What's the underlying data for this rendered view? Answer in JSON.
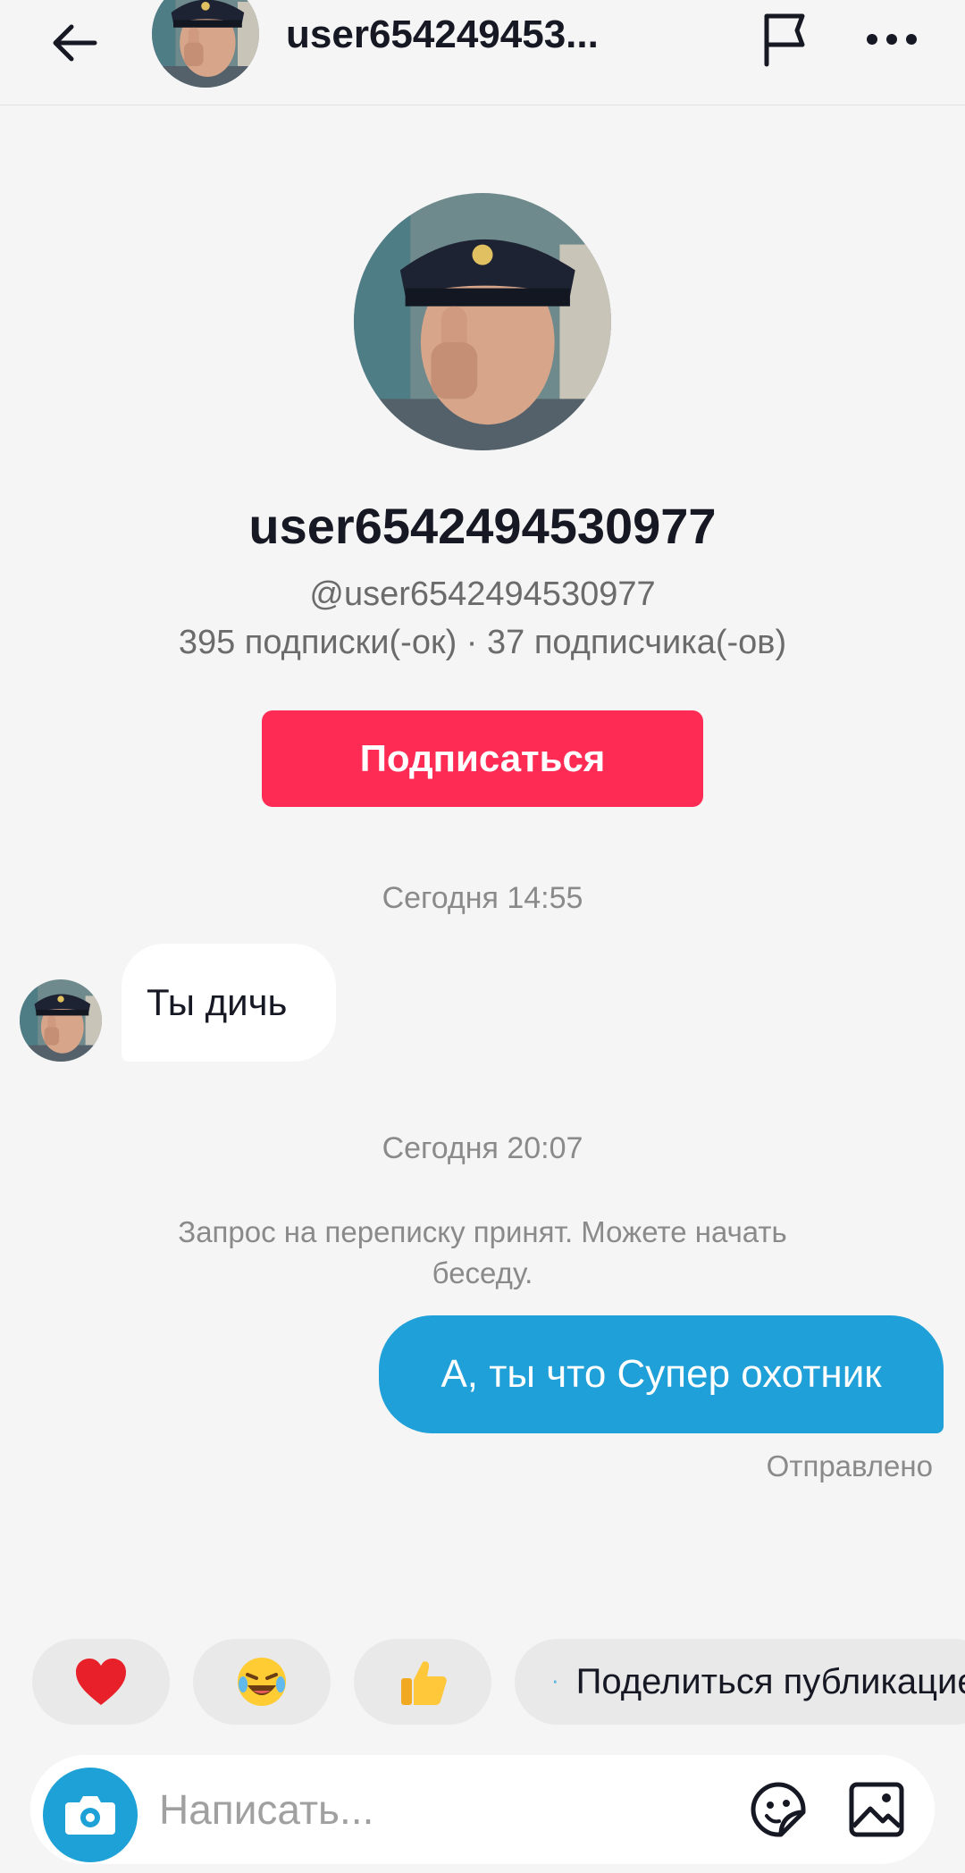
{
  "header": {
    "username": "user654249453...",
    "back_icon": "arrow-left-icon",
    "report_icon": "flag-icon",
    "more_icon": "more-dots-icon"
  },
  "profile": {
    "display_name": "user6542494530977",
    "handle": "@user6542494530977",
    "stats": "395 подписки(-ок) · 37 подписчика(-ов)",
    "follow_label": "Подписаться"
  },
  "chat": {
    "timestamp_1": "Сегодня 14:55",
    "incoming_message": "Ты дичь",
    "timestamp_2": "Сегодня 20:07",
    "system_note": "Запрос на переписку принят. Можете начать беседу.",
    "outgoing_message": "А, ты что Супер охотник",
    "sent_status": "Отправлено"
  },
  "quick_replies": {
    "heart": "❤️",
    "laugh": "😂",
    "thumbs_up": "👍",
    "share_label": "Поделиться публикацией"
  },
  "composer": {
    "placeholder": "Написать...",
    "camera_icon": "camera-icon",
    "sticker_icon": "sticker-icon",
    "image_icon": "image-icon"
  },
  "colors": {
    "follow_button": "#fe2c55",
    "outgoing_bubble": "#20a0d8",
    "camera_button": "#1da1d6",
    "background": "#f5f5f5"
  }
}
